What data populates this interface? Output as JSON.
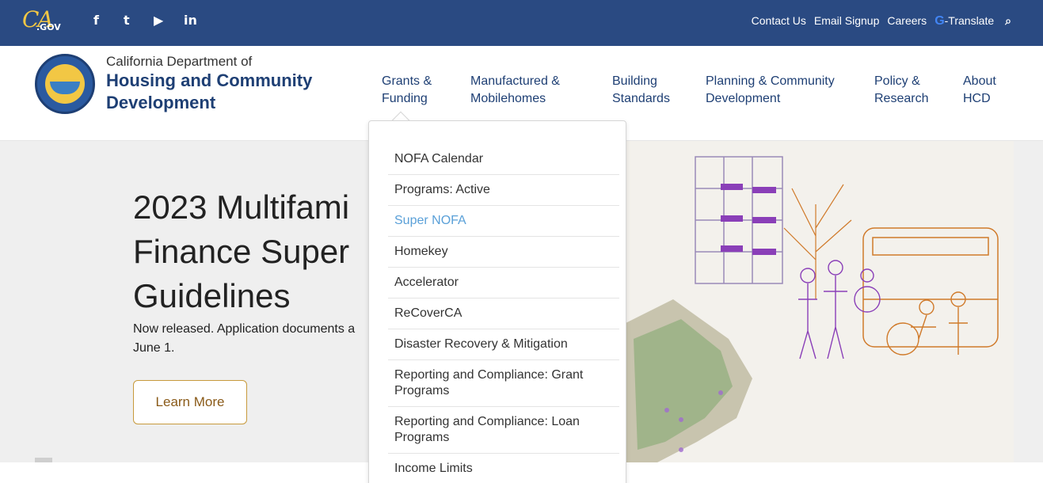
{
  "topbar": {
    "logo_ca": "CA",
    "logo_gov": ".GOV",
    "social": [
      "f",
      "t",
      "▶",
      "in"
    ],
    "links": [
      "Contact Us",
      "Email Signup",
      "Careers"
    ],
    "translate_g": "G",
    "translate_label": "-Translate",
    "search_icon": "magnifier"
  },
  "header": {
    "org_line1": "California Department of",
    "org_line2": "Housing and Community",
    "org_line3": "Development",
    "nav": [
      {
        "line1": "Grants &",
        "line2": "Funding"
      },
      {
        "line1": "Manufactured &",
        "line2": "Mobilehomes"
      },
      {
        "line1": "Building",
        "line2": "Standards"
      },
      {
        "line1": "Planning & Community",
        "line2": "Development"
      },
      {
        "line1": "Policy &",
        "line2": "Research"
      },
      {
        "line1": "About",
        "line2": "HCD"
      }
    ]
  },
  "hero": {
    "title_line1": "2023 Multifami",
    "title_line2": "Finance Super",
    "title_line3": "Guidelines",
    "text_line1": "Now released. Application documents a",
    "text_line2": "June 1.",
    "cta": "Learn More"
  },
  "dropdown": {
    "items": [
      {
        "label": "NOFA Calendar",
        "active": false
      },
      {
        "label": "Programs: Active",
        "active": false
      },
      {
        "label": "Super NOFA",
        "active": true
      },
      {
        "label": "Homekey",
        "active": false
      },
      {
        "label": "Accelerator",
        "active": false
      },
      {
        "label": "ReCoverCA",
        "active": false
      },
      {
        "label": "Disaster Recovery & Mitigation",
        "active": false
      },
      {
        "label": "Reporting and Compliance: Grant Programs",
        "active": false
      },
      {
        "label": "Reporting and Compliance: Loan Programs",
        "active": false
      },
      {
        "label": "Income Limits",
        "active": false
      }
    ]
  },
  "colors": {
    "topbar": "#2a4a82",
    "nav_text": "#1e3f74",
    "active_item": "#5aa0d8",
    "cta_border": "#c79a3c"
  }
}
